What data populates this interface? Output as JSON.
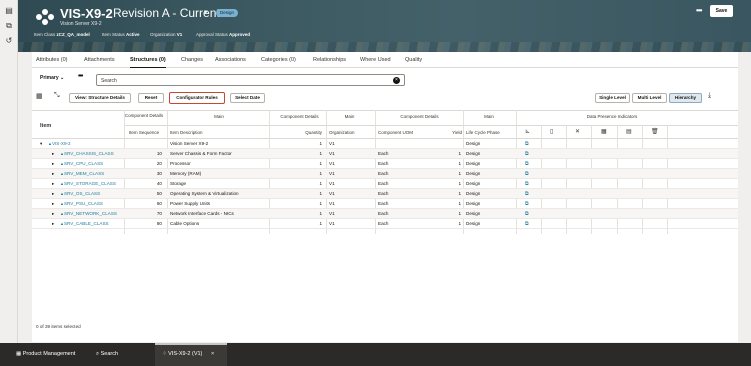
{
  "header": {
    "title": "VIS-X9-2",
    "subtitle": "Vision Server X9-2",
    "revision": "Revision A - Current",
    "badge": "Design",
    "meta": [
      {
        "label": "Item Class",
        "value": "zCZ_QA_model"
      },
      {
        "label": "Item Status",
        "value": "Active"
      },
      {
        "label": "Organization",
        "value": "V1"
      },
      {
        "label": "Approval Status",
        "value": "Approved"
      }
    ],
    "save_label": "Save"
  },
  "tabs": [
    {
      "label": "Attributes (0)"
    },
    {
      "label": "Attachments"
    },
    {
      "label": "Structures (0)"
    },
    {
      "label": "Changes"
    },
    {
      "label": "Associations"
    },
    {
      "label": "Categories (0)"
    },
    {
      "label": "Relationships"
    },
    {
      "label": "Where Used"
    },
    {
      "label": "Quality"
    }
  ],
  "toolbar": {
    "structure_select": "Primary",
    "search_placeholder": "Search",
    "view_details": "View: Structure Details",
    "reset": "Reset",
    "configurator_rules": "Configurator Rules",
    "select_date": "Select Date",
    "single_level": "Single Level",
    "multi_level": "Multi Level",
    "hierarchy": "Hierarchy"
  },
  "table": {
    "groups": {
      "item": "Item",
      "component_details": "Component Details",
      "main1": "Main",
      "component_details2": "Component Details",
      "main2": "Main",
      "component_details3": "Component Details",
      "main3": "Main",
      "dpi": "Data Presence Indicators"
    },
    "columns": {
      "item_sequence": "Item Sequence",
      "item_description": "Item Description",
      "quantity": "Quantity",
      "organization": "Organization",
      "component_uom": "Component UOM",
      "yield": "Yield",
      "lifecycle_phase": "Life Cycle Phase"
    },
    "rows": [
      {
        "item": "VIS-X9-2",
        "seq": "",
        "desc": "Vision Server X9-2",
        "qty": "1",
        "org": "V1",
        "uom": "",
        "yield": "",
        "phase": "Design"
      },
      {
        "item": "SRV_CHASSIS_CLASS",
        "seq": "10",
        "desc": "Server Chassis & Form Factor",
        "qty": "1",
        "org": "V1",
        "uom": "Each",
        "yield": "1",
        "phase": "Design"
      },
      {
        "item": "SRV_CPU_CLASS",
        "seq": "20",
        "desc": "Processor",
        "qty": "1",
        "org": "V1",
        "uom": "Each",
        "yield": "1",
        "phase": "Design"
      },
      {
        "item": "SRV_MEM_CLASS",
        "seq": "30",
        "desc": "Memory (RAM)",
        "qty": "1",
        "org": "V1",
        "uom": "Each",
        "yield": "1",
        "phase": "Design"
      },
      {
        "item": "SRV_STORAGE_CLASS",
        "seq": "40",
        "desc": "Storage",
        "qty": "1",
        "org": "V1",
        "uom": "Each",
        "yield": "1",
        "phase": "Design"
      },
      {
        "item": "SRV_OS_CLASS",
        "seq": "50",
        "desc": "Operating System & Virtualization",
        "qty": "1",
        "org": "V1",
        "uom": "Each",
        "yield": "1",
        "phase": "Design"
      },
      {
        "item": "SRV_PSU_CLASS",
        "seq": "60",
        "desc": "Power Supply Units",
        "qty": "1",
        "org": "V1",
        "uom": "Each",
        "yield": "1",
        "phase": "Design"
      },
      {
        "item": "SRV_NETWORK_CLASS",
        "seq": "70",
        "desc": "Network Interface Cards - NICs",
        "qty": "1",
        "org": "V1",
        "uom": "Each",
        "yield": "1",
        "phase": "Design"
      },
      {
        "item": "SRV_CABLE_CLASS",
        "seq": "80",
        "desc": "Cable Options",
        "qty": "1",
        "org": "V1",
        "uom": "Each",
        "yield": "1",
        "phase": "Design"
      }
    ],
    "footer": "0 of 39 items selected"
  },
  "bottombar": {
    "product_management": "Product Management",
    "search": "Search",
    "active_tab": "VIS-X9-2 (V1)"
  },
  "colors": {
    "header_bg": "#3d5a63",
    "link": "#227e9e",
    "highlight_border": "#c74634",
    "bottom_bar": "#2b2a28"
  }
}
